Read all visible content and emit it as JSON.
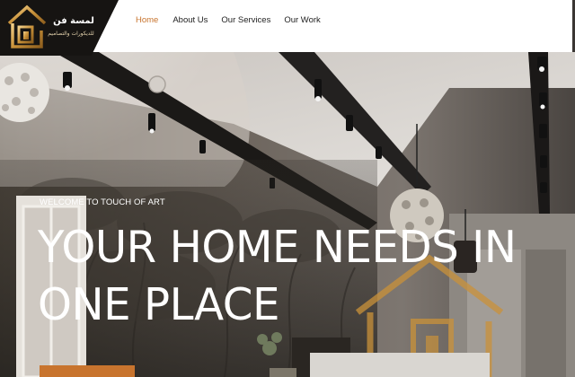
{
  "logo": {
    "name": "لمسة فن",
    "tagline": "للديكورات والتصاميم"
  },
  "nav": {
    "items": [
      {
        "label": "Home",
        "active": true
      },
      {
        "label": "About Us",
        "active": false
      },
      {
        "label": "Our Services",
        "active": false
      },
      {
        "label": "Our Work",
        "active": false
      }
    ]
  },
  "hero": {
    "welcome": "WELCOME TO TOUCH OF ART",
    "headline_line1": "YOUR HOME NEEDS IN",
    "headline_line2": "ONE PLACE"
  },
  "colors": {
    "accent": "#c8742e",
    "header_bg": "#ffffff",
    "logo_bg": "#161412",
    "logo_gold": "#d9a64a"
  }
}
